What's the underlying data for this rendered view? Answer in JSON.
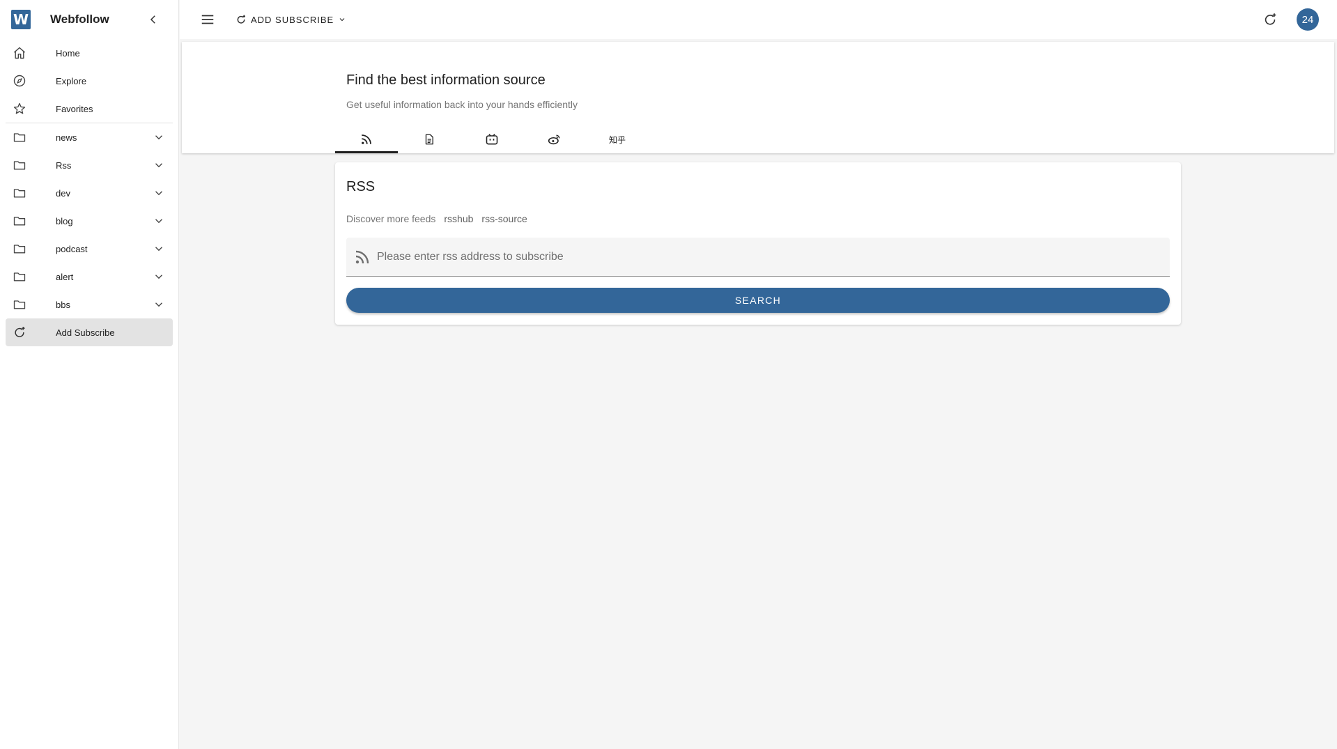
{
  "brand": {
    "logo_letter": "W",
    "name": "Webfollow",
    "color": "#336699"
  },
  "sidebar": {
    "main_items": [
      {
        "label": "Home",
        "icon": "home-icon"
      },
      {
        "label": "Explore",
        "icon": "compass-icon"
      },
      {
        "label": "Favorites",
        "icon": "star-icon"
      }
    ],
    "folders": [
      {
        "label": "news",
        "icon": "folder-icon"
      },
      {
        "label": "Rss",
        "icon": "folder-icon"
      },
      {
        "label": "dev",
        "icon": "folder-icon"
      },
      {
        "label": "blog",
        "icon": "folder-icon"
      },
      {
        "label": "podcast",
        "icon": "folder-icon"
      },
      {
        "label": "alert",
        "icon": "folder-icon"
      },
      {
        "label": "bbs",
        "icon": "folder-icon"
      }
    ],
    "add_subscribe": {
      "label": "Add Subscribe",
      "icon": "refresh-plus-icon",
      "active": true
    }
  },
  "topbar": {
    "add_subscribe_label": "ADD SUBSCRIBE",
    "avatar_text": "24"
  },
  "header": {
    "title": "Find the best information source",
    "subtitle": "Get useful information back into your hands efficiently",
    "tabs": [
      {
        "icon": "rss-icon",
        "active": true
      },
      {
        "icon": "document-icon",
        "active": false
      },
      {
        "icon": "bilibili-icon",
        "active": false
      },
      {
        "icon": "weibo-icon",
        "active": false
      },
      {
        "label": "知乎",
        "active": false
      }
    ]
  },
  "rss_card": {
    "title": "RSS",
    "discover_label": "Discover more feeds",
    "links": [
      "rsshub",
      "rss-source"
    ],
    "input_value": "",
    "input_placeholder": "Please enter rss address to subscribe",
    "search_label": "SEARCH"
  }
}
